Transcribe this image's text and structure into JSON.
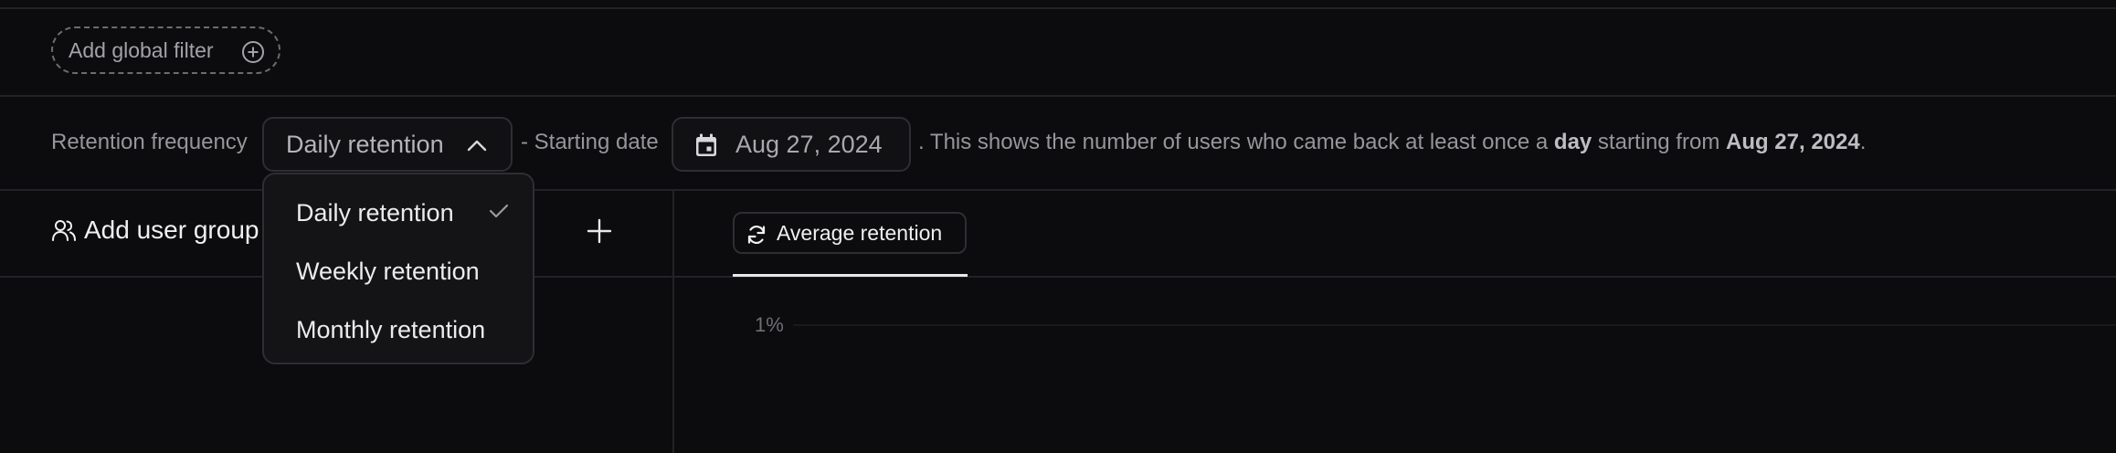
{
  "global_filter": {
    "label": "Add global filter",
    "icon": "plus-circle-icon"
  },
  "retention": {
    "frequency_label": "Retention frequency",
    "selected": "Daily retention",
    "starting_label": "- Starting date",
    "date": "Aug 27, 2024",
    "description": {
      "prefix": ". This shows the number of users who came back at least once a ",
      "unit": "day",
      "middle": " starting from ",
      "date": "Aug 27, 2024",
      "suffix": "."
    }
  },
  "dropdown": {
    "open": true,
    "options": [
      {
        "label": "Daily retention",
        "checked": true
      },
      {
        "label": "Weekly retention",
        "checked": false
      },
      {
        "label": "Monthly retention",
        "checked": false
      }
    ]
  },
  "user_groups": {
    "add_label": "Add user group"
  },
  "tabs": {
    "active_label": "Average retention"
  },
  "chart": {
    "y_tick": "1%"
  },
  "colors": {
    "background": "#0c0c0e",
    "border": "#2e2e33",
    "text_primary": "#f0f0f2",
    "text_secondary": "#96969b"
  }
}
